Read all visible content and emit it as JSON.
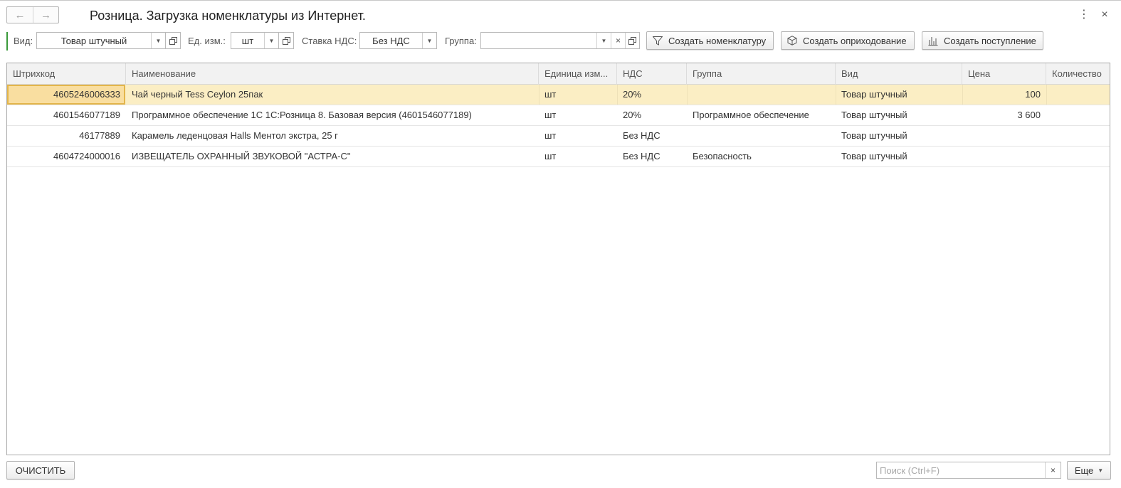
{
  "window": {
    "title": "Розница. Загрузка номенклатуры из Интернет.",
    "nav_back_icon": "arrow-left-icon",
    "nav_forward_icon": "arrow-right-icon",
    "menu_icon": "more-vertical-icon",
    "close_icon": "close-icon"
  },
  "filters": {
    "vid": {
      "label": "Вид:",
      "value": "Товар штучный"
    },
    "unit": {
      "label": "Ед. изм.:",
      "value": "шт"
    },
    "vat": {
      "label": "Ставка НДС:",
      "value": "Без НДС"
    },
    "group": {
      "label": "Группа:",
      "value": ""
    }
  },
  "toolbar": {
    "create_nomenclature": "Создать номенклатуру",
    "create_receipt": "Создать оприходование",
    "create_arrival": "Создать поступление"
  },
  "table": {
    "columns": [
      "Штрихкод",
      "Наименование",
      "Единица изм...",
      "НДС",
      "Группа",
      "Вид",
      "Цена",
      "Количество"
    ],
    "rows": [
      {
        "barcode": "4605246006333",
        "name": "Чай черный Tess Ceylon 25пак",
        "unit": "шт",
        "vat": "20%",
        "group": "",
        "kind": "Товар штучный",
        "price": "100",
        "qty": ""
      },
      {
        "barcode": "4601546077189",
        "name": "Программное обеспечение 1С 1С:Розница 8. Базовая версия (4601546077189)",
        "unit": "шт",
        "vat": "20%",
        "group": "Программное обеспечение",
        "kind": "Товар штучный",
        "price": "3 600",
        "qty": ""
      },
      {
        "barcode": "46177889",
        "name": "Карамель леденцовая Halls Ментол экстра, 25 г",
        "unit": "шт",
        "vat": "Без НДС",
        "group": "",
        "kind": "Товар штучный",
        "price": "",
        "qty": ""
      },
      {
        "barcode": "4604724000016",
        "name": "ИЗВЕЩАТЕЛЬ ОХРАННЫЙ ЗВУКОВОЙ \"АСТРА-С\"",
        "unit": "шт",
        "vat": "Без НДС",
        "group": "Безопасность",
        "kind": "Товар штучный",
        "price": "",
        "qty": ""
      }
    ]
  },
  "footer": {
    "clear_label": "ОЧИСТИТЬ",
    "search_placeholder": "Поиск (Ctrl+F)",
    "more_label": "Еще"
  },
  "colors": {
    "selected_row": "#fbeec4",
    "focused_cell": "#f9dea0",
    "accent_green": "#3a9a3a"
  }
}
